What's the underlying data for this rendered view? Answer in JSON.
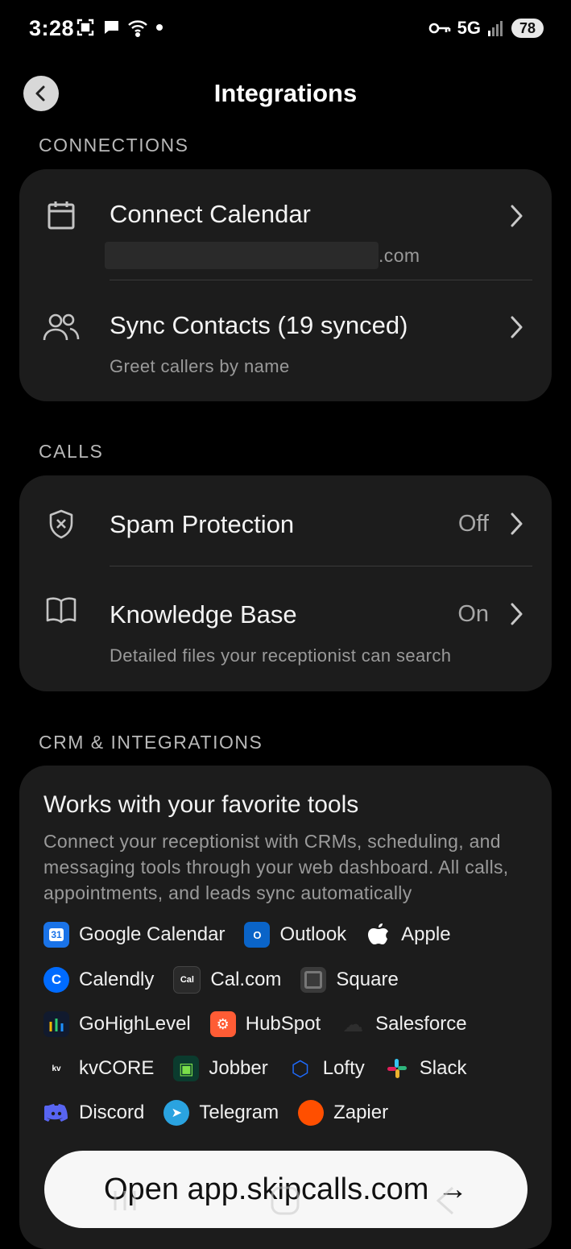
{
  "status_bar": {
    "time": "3:28",
    "network": "5G",
    "battery": "78"
  },
  "header": {
    "title": "Integrations"
  },
  "sections": {
    "connections": "CONNECTIONS",
    "calls": "CALLS",
    "crm": "CRM & INTEGRATIONS"
  },
  "connections": {
    "calendar": {
      "title": "Connect Calendar",
      "subtitle": ".com"
    },
    "contacts": {
      "title": "Sync Contacts (19 synced)",
      "subtitle": "Greet callers by name"
    }
  },
  "calls": {
    "spam": {
      "title": "Spam Protection",
      "value": "Off"
    },
    "knowledge": {
      "title": "Knowledge Base",
      "value": "On",
      "subtitle": "Detailed files your receptionist can search"
    }
  },
  "tools": {
    "title": "Works with your favorite tools",
    "description": "Connect your receptionist with CRMs, scheduling, and messaging tools through your web dashboard. All calls, appointments, and leads sync automatically",
    "items": [
      {
        "name": "Google Calendar",
        "logo": "31",
        "color": "#1a73e8"
      },
      {
        "name": "Outlook",
        "logo": "O",
        "color": "#0a64c8"
      },
      {
        "name": "Apple",
        "logo": "",
        "color": "#000000"
      },
      {
        "name": "Calendly",
        "logo": "C",
        "color": "#006bff"
      },
      {
        "name": "Cal.com",
        "logo": "Cal",
        "color": "#2a2a2a"
      },
      {
        "name": "Square",
        "logo": "",
        "color": "#3a3a3a"
      },
      {
        "name": "GoHighLevel",
        "logo": "↑",
        "color": "#111a2e"
      },
      {
        "name": "HubSpot",
        "logo": "⚙",
        "color": "#ff5c35"
      },
      {
        "name": "Salesforce",
        "logo": "☁",
        "color": "#1c1c1c"
      },
      {
        "name": "kvCORE",
        "logo": "kv",
        "color": "#1c1c1c"
      },
      {
        "name": "Jobber",
        "logo": "▣",
        "color": "#0b3b2e"
      },
      {
        "name": "Lofty",
        "logo": "⬡",
        "color": "#1c1c1c"
      },
      {
        "name": "Slack",
        "logo": "✚",
        "color": "#1c1c1c"
      },
      {
        "name": "Discord",
        "logo": "☺",
        "color": "#5865f2"
      },
      {
        "name": "Telegram",
        "logo": "➤",
        "color": "#2aa3e0"
      },
      {
        "name": "Zapier",
        "logo": "",
        "color": "#ff4f00"
      }
    ]
  },
  "cta": {
    "label": "Open app.skipcalls.com →"
  }
}
